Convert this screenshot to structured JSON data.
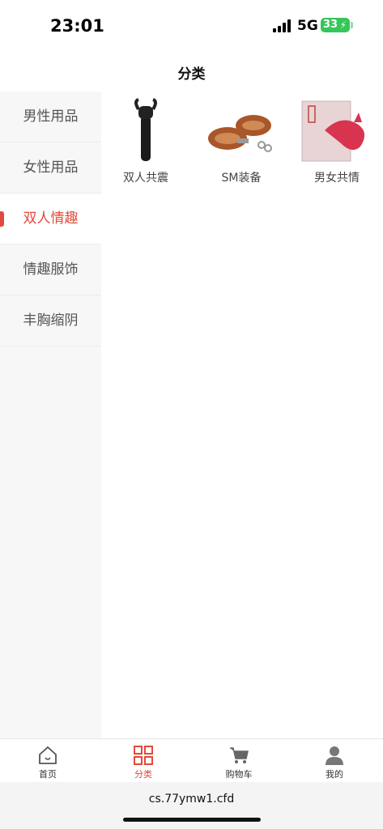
{
  "status_bar": {
    "time": "23:01",
    "network": "5G",
    "battery": "33"
  },
  "header": {
    "title": "分类"
  },
  "sidebar": {
    "items": [
      {
        "label": "男性用品",
        "active": false
      },
      {
        "label": "女性用品",
        "active": false
      },
      {
        "label": "双人情趣",
        "active": true
      },
      {
        "label": "情趣服饰",
        "active": false
      },
      {
        "label": "丰胸缩阴",
        "active": false
      }
    ]
  },
  "categories": [
    {
      "label": "双人共震",
      "icon": "wand-product-image"
    },
    {
      "label": "SM装备",
      "icon": "leather-cuffs-image"
    },
    {
      "label": "男女共情",
      "icon": "pink-vibrator-box-image"
    }
  ],
  "tab_bar": {
    "tabs": [
      {
        "label": "首页",
        "icon": "home-icon",
        "active": false
      },
      {
        "label": "分类",
        "icon": "grid-icon",
        "active": true
      },
      {
        "label": "购物车",
        "icon": "cart-icon",
        "active": false
      },
      {
        "label": "我的",
        "icon": "user-icon",
        "active": false
      }
    ]
  },
  "url_bar": {
    "url": "cs.77ymw1.cfd"
  },
  "colors": {
    "accent": "#e14a3b",
    "sidebar_bg": "#f7f7f7",
    "battery": "#34c759"
  }
}
